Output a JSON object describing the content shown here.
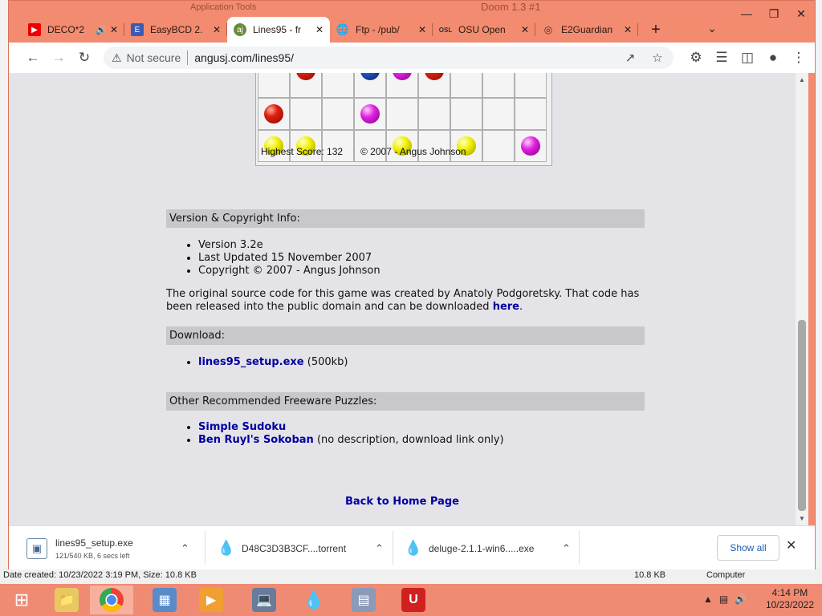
{
  "window": {
    "ghost_title": "Application Tools",
    "ghost_title2": "Doom 1.3 #1"
  },
  "tabs": [
    {
      "label": "DECO*2",
      "icon": "youtube-icon",
      "audio": "🔊"
    },
    {
      "label": "EasyBCD 2.",
      "icon": "easybcd-icon"
    },
    {
      "label": "Lines95 - fr",
      "icon": "lines95-icon",
      "active": true
    },
    {
      "label": "Ftp - /pub/",
      "icon": "globe-icon"
    },
    {
      "label": "OSU Open",
      "icon": "osu-icon"
    },
    {
      "label": "E2Guardian",
      "icon": "e2guardian-icon"
    }
  ],
  "address": {
    "security": "Not secure",
    "url": "angusj.com/lines95/"
  },
  "game": {
    "status_score": "Highest Score: 132",
    "status_copy": "© 2007 - Angus Johnson",
    "rows": [
      [
        "",
        "red",
        "",
        "blue",
        "magenta",
        "red",
        "",
        "",
        ""
      ],
      [
        "red",
        "",
        "",
        "magenta",
        "",
        "",
        "",
        "",
        ""
      ],
      [
        "yellow",
        "yellow",
        "",
        "",
        "yellow",
        "",
        "yellow",
        "",
        "magenta"
      ]
    ]
  },
  "sections": {
    "version_title": "Version & Copyright Info:",
    "version_items": [
      "Version 3.2e",
      "Last Updated 15 November 2007",
      "Copyright © 2007 - Angus Johnson"
    ],
    "source_text": "The original source code for this game was created by Anatoly Podgoretsky. That code has been released into the public domain and can be downloaded ",
    "source_link": "here",
    "download_title": "Download:",
    "download_link": "lines95_setup.exe",
    "download_size": " (500kb)",
    "other_title": "Other Recommended Freeware Puzzles:",
    "other_link1": "Simple Sudoku",
    "other_link2": "Ben Ruyl's Sokoban",
    "other_note2": " (no description, download link only)",
    "back_home": "Back to Home Page"
  },
  "downloads": [
    {
      "name": "lines95_setup.exe",
      "progress": "121/540 KB, 6 secs left"
    },
    {
      "name": "D48C3D3B3CF....torrent"
    },
    {
      "name": "deluge-2.1.1-win6.....exe"
    }
  ],
  "shelf": {
    "show_all": "Show all"
  },
  "background": {
    "status_left": "Date created: 10/23/2022 3:19 PM, Size: 10.8 KB",
    "status_size": "10.8 KB",
    "status_computer": "Computer"
  },
  "taskbar": {
    "time": "4:14 PM",
    "date": "10/23/2022"
  },
  "colors": {
    "chrome_frame": "#f28b6f",
    "link": "#0000a0",
    "section_bar": "#c8c7cc",
    "page_bg": "#e4e3e8"
  }
}
